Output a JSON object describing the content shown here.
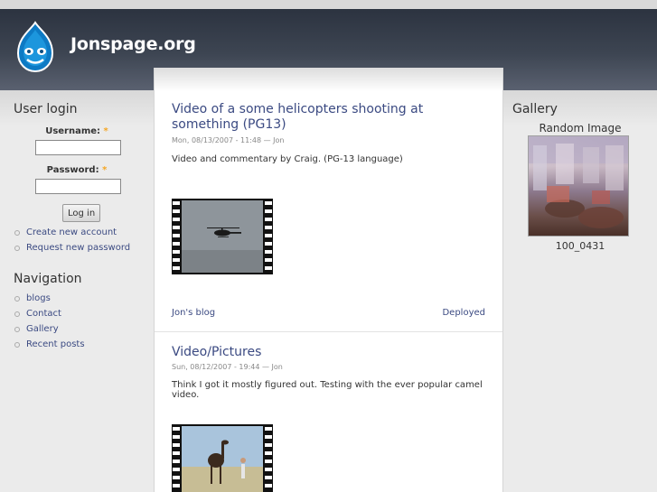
{
  "site": {
    "name": "Jonspage.org"
  },
  "user_login": {
    "title": "User login",
    "username_label": "Username:",
    "password_label": "Password:",
    "required_mark": "*",
    "login_button": "Log in",
    "links": [
      "Create new account",
      "Request new password"
    ]
  },
  "navigation": {
    "title": "Navigation",
    "items": [
      "blogs",
      "Contact",
      "Gallery",
      "Recent posts"
    ]
  },
  "posts": [
    {
      "title": "Video of a some helicopters shooting at something (PG13)",
      "meta": "Mon, 08/13/2007 - 11:48 — Jon",
      "body": "Video and commentary by Craig. (PG-13 language)",
      "footer_left": "Jon's blog",
      "footer_right": "Deployed"
    },
    {
      "title": "Video/Pictures",
      "meta": "Sun, 08/12/2007 - 19:44 — Jon",
      "body": "Think I got it mostly figured out. Testing with the ever popular camel video."
    }
  ],
  "gallery": {
    "title": "Gallery",
    "subtitle": "Random Image",
    "image_caption": "100_0431"
  },
  "colors": {
    "link": "#3b4a82",
    "header_dark": "#2c3340",
    "required": "#f5a623"
  }
}
